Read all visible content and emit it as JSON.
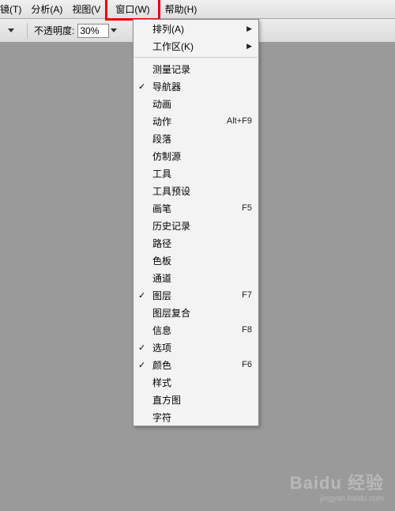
{
  "menubar": {
    "items": [
      {
        "label": "镜(T)"
      },
      {
        "label": "分析(A)"
      },
      {
        "label": "视图(V"
      },
      {
        "label": "窗口(W)"
      },
      {
        "label": "帮助(H)"
      }
    ]
  },
  "toolbar": {
    "opacity_label": "不透明度:",
    "opacity_value": "30%"
  },
  "dropdown": {
    "items": [
      {
        "label": "排列(A)",
        "submenu": true
      },
      {
        "label": "工作区(K)",
        "submenu": true
      },
      {
        "sep": true
      },
      {
        "label": "测量记录"
      },
      {
        "label": "导航器",
        "checked": true
      },
      {
        "label": "动画"
      },
      {
        "label": "动作",
        "shortcut": "Alt+F9"
      },
      {
        "label": "段落"
      },
      {
        "label": "仿制源"
      },
      {
        "label": "工具"
      },
      {
        "label": "工具预设"
      },
      {
        "label": "画笔",
        "shortcut": "F5"
      },
      {
        "label": "历史记录"
      },
      {
        "label": "路径"
      },
      {
        "label": "色板"
      },
      {
        "label": "通道"
      },
      {
        "label": "图层",
        "checked": true,
        "shortcut": "F7"
      },
      {
        "label": "图层复合"
      },
      {
        "label": "信息",
        "shortcut": "F8"
      },
      {
        "label": "选项",
        "checked": true
      },
      {
        "label": "颜色",
        "checked": true,
        "shortcut": "F6"
      },
      {
        "label": "样式"
      },
      {
        "label": "直方图"
      },
      {
        "label": "字符"
      }
    ]
  },
  "watermark": {
    "big": "Baidu 经验",
    "small": "jingyan.baidu.com"
  }
}
